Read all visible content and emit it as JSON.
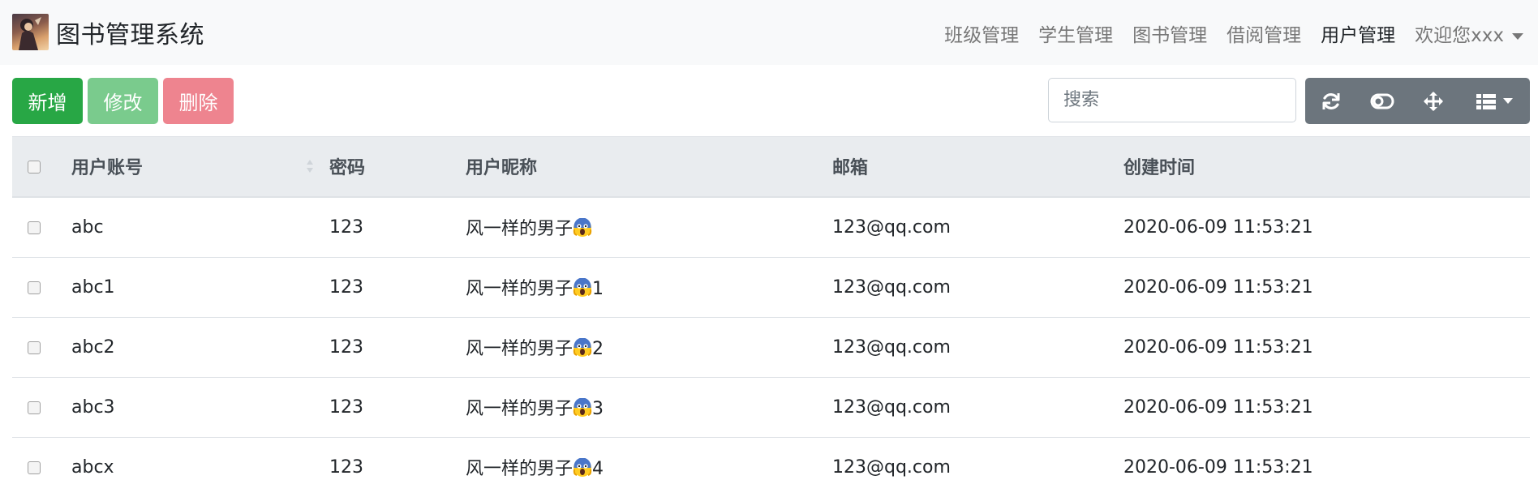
{
  "app": {
    "title": "图书管理系统"
  },
  "nav": {
    "items": [
      "班级管理",
      "学生管理",
      "图书管理",
      "借阅管理",
      "用户管理"
    ],
    "active_index": 4,
    "user_label": "欢迎您xxx"
  },
  "toolbar": {
    "add_label": "新增",
    "edit_label": "修改",
    "delete_label": "删除",
    "search_placeholder": "搜索"
  },
  "table": {
    "columns": [
      "用户账号",
      "密码",
      "用户昵称",
      "邮箱",
      "创建时间"
    ],
    "rows": [
      {
        "account": "abc",
        "password": "123",
        "nickname": "风一样的男子",
        "nick_suffix": "",
        "email": "123@qq.com",
        "created": "2020-06-09 11:53:21"
      },
      {
        "account": "abc1",
        "password": "123",
        "nickname": "风一样的男子",
        "nick_suffix": "1",
        "email": "123@qq.com",
        "created": "2020-06-09 11:53:21"
      },
      {
        "account": "abc2",
        "password": "123",
        "nickname": "风一样的男子",
        "nick_suffix": "2",
        "email": "123@qq.com",
        "created": "2020-06-09 11:53:21"
      },
      {
        "account": "abc3",
        "password": "123",
        "nickname": "风一样的男子",
        "nick_suffix": "3",
        "email": "123@qq.com",
        "created": "2020-06-09 11:53:21"
      },
      {
        "account": "abcx",
        "password": "123",
        "nickname": "风一样的男子",
        "nick_suffix": "4",
        "email": "123@qq.com",
        "created": "2020-06-09 11:53:21"
      }
    ]
  },
  "icons": {
    "logo": "avatar-logo",
    "nickname_emoji": "screaming-face-emoji",
    "tools": [
      "refresh-icon",
      "toggle-icon",
      "fullscreen-move-icon",
      "columns-list-icon"
    ]
  },
  "colors": {
    "primary_green": "#28a745",
    "edit_green_disabled": "#7acb8d",
    "delete_red_disabled": "#ee848f",
    "tool_gray": "#6c757d",
    "header_bg": "#e9ecef"
  }
}
